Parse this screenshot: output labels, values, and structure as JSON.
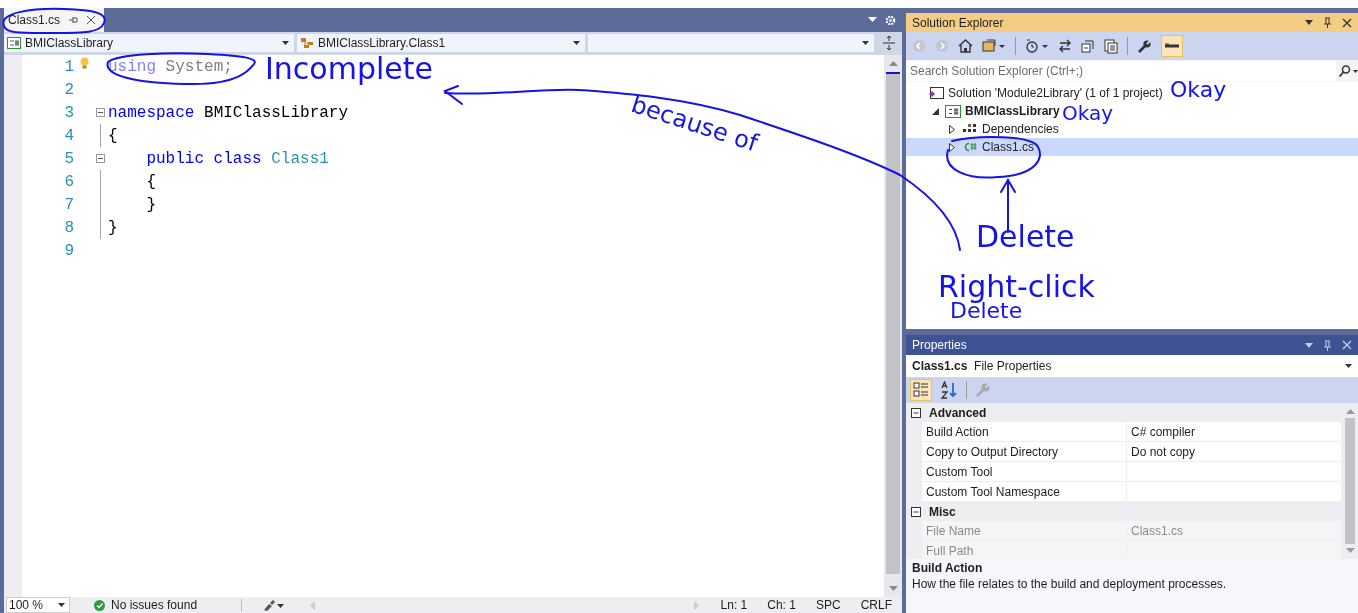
{
  "editor": {
    "tabs": [
      {
        "label": "Class1.cs",
        "selected": true
      }
    ],
    "nav": [
      "BMIClassLibrary",
      "BMIClassLibrary.Class1"
    ],
    "lines": [
      {
        "number": "1",
        "foldable": false,
        "lightbulb": true,
        "tokens": [
          {
            "text": "using",
            "kind": "faded-keyword"
          },
          {
            "text": " System;",
            "kind": "faded"
          }
        ]
      },
      {
        "number": "2",
        "foldable": false,
        "lightbulb": false
      },
      {
        "number": "3",
        "foldable": true,
        "lightbulb": false,
        "tokens": [
          {
            "text": "namespace",
            "kind": "keyword"
          },
          {
            "text": " BMIClassLibrary",
            "kind": "plain"
          }
        ]
      },
      {
        "number": "4",
        "foldable": false,
        "lightbulb": false,
        "tokens": [
          {
            "text": "{",
            "kind": "plain"
          }
        ]
      },
      {
        "number": "5",
        "foldable": true,
        "lightbulb": false,
        "tokens": [
          {
            "text": "    public class",
            "kind": "keyword"
          },
          {
            "text": " Class1",
            "kind": "type"
          }
        ]
      },
      {
        "number": "6",
        "foldable": false,
        "lightbulb": false,
        "tokens": [
          {
            "text": "    {",
            "kind": "plain"
          }
        ]
      },
      {
        "number": "7",
        "foldable": false,
        "lightbulb": false,
        "tokens": [
          {
            "text": "    }",
            "kind": "plain"
          }
        ]
      },
      {
        "number": "8",
        "foldable": false,
        "lightbulb": false,
        "tokens": [
          {
            "text": "}",
            "kind": "plain"
          }
        ]
      },
      {
        "number": "9",
        "foldable": false,
        "lightbulb": false
      }
    ],
    "status": {
      "zoom": "100 %",
      "issues": "No issues found",
      "line": "Ln: 1",
      "col": "Ch: 1",
      "spacing": "SPC",
      "eol": "CRLF"
    }
  },
  "solution_explorer": {
    "title": "Solution Explorer",
    "search": {
      "placeholder": "Search Solution Explorer (Ctrl+;)"
    },
    "tree": [
      {
        "label": "Solution 'Module2Library' (1 of 1 project)",
        "kind": "solution",
        "selected": false,
        "children": [
          {
            "label": "BMIClassLibrary",
            "kind": "project",
            "selected": false,
            "expanded": true,
            "children": [
              {
                "label": "Dependencies",
                "kind": "dependencies",
                "selected": false,
                "expanded": false
              },
              {
                "label": "Class1.cs",
                "kind": "csharp-file",
                "selected": true,
                "expanded": false
              }
            ]
          }
        ]
      }
    ]
  },
  "properties": {
    "title": "Properties",
    "object_name": "Class1.cs",
    "object_type": "File Properties",
    "categories": [
      {
        "name": "Advanced",
        "expanded": true,
        "rows": [
          {
            "name": "Build Action",
            "value": "C# compiler",
            "disabled": false
          },
          {
            "name": "Copy to Output Directory",
            "value": "Do not copy",
            "disabled": false
          },
          {
            "name": "Custom Tool",
            "disabled": false
          },
          {
            "name": "Custom Tool Namespace",
            "disabled": false
          }
        ]
      },
      {
        "name": "Misc",
        "expanded": true,
        "rows": [
          {
            "name": "File Name",
            "value": "Class1.cs",
            "disabled": true
          },
          {
            "name": "Full Path",
            "disabled": true
          }
        ]
      }
    ],
    "description_title": "Build Action",
    "description": "How the file relates to the build and deployment processes."
  },
  "annotations": [
    "Incomplete",
    "because of",
    "Okay",
    "Okay",
    "Delete",
    "Right-click",
    "Delete"
  ]
}
